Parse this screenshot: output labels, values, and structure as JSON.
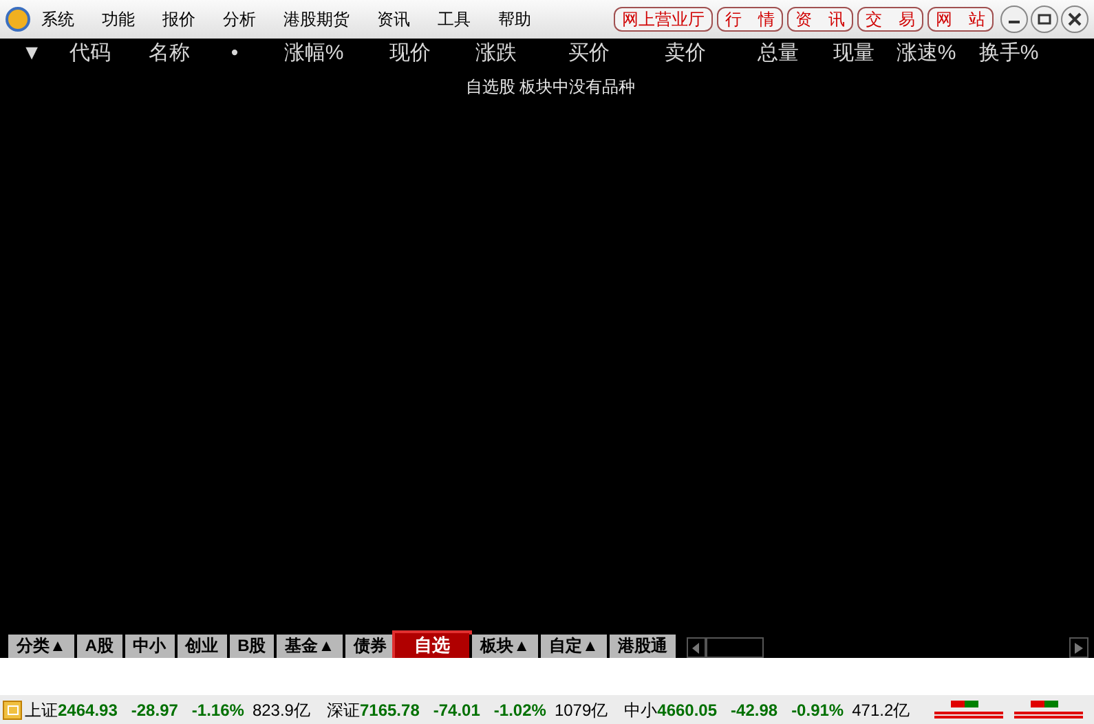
{
  "menu": [
    "系统",
    "功能",
    "报价",
    "分析",
    "港股期货",
    "资讯",
    "工具",
    "帮助"
  ],
  "quick_buttons": [
    "网上营业厅",
    "行　情",
    "资　讯",
    "交　易",
    "网　站"
  ],
  "columns": [
    "▼",
    "代码",
    "名称",
    "•",
    "涨幅%",
    "现价",
    "涨跌",
    "买价",
    "卖价",
    "总量",
    "现量",
    "涨速%",
    "换手%"
  ],
  "message": "自选股 板块中没有品种",
  "tabs": [
    {
      "label": "分类▲",
      "selected": false
    },
    {
      "label": "A股",
      "selected": false
    },
    {
      "label": "中小",
      "selected": false
    },
    {
      "label": "创业",
      "selected": false
    },
    {
      "label": "B股",
      "selected": false
    },
    {
      "label": "基金▲",
      "selected": false
    },
    {
      "label": "债券",
      "selected": false
    },
    {
      "label": "自选",
      "selected": true
    },
    {
      "label": "板块▲",
      "selected": false
    },
    {
      "label": "自定▲",
      "selected": false
    },
    {
      "label": "港股通",
      "selected": false
    }
  ],
  "indices": [
    {
      "name": "上证",
      "value": "2464.93",
      "change": "-28.97",
      "percent": "-1.16%",
      "amount": "823.9亿"
    },
    {
      "name": "深证",
      "value": "7165.78",
      "change": "-74.01",
      "percent": "-1.02%",
      "amount": "1079亿"
    },
    {
      "name": "中小",
      "value": "4660.05",
      "change": "-42.98",
      "percent": "-0.91%",
      "amount": "471.2亿"
    }
  ]
}
